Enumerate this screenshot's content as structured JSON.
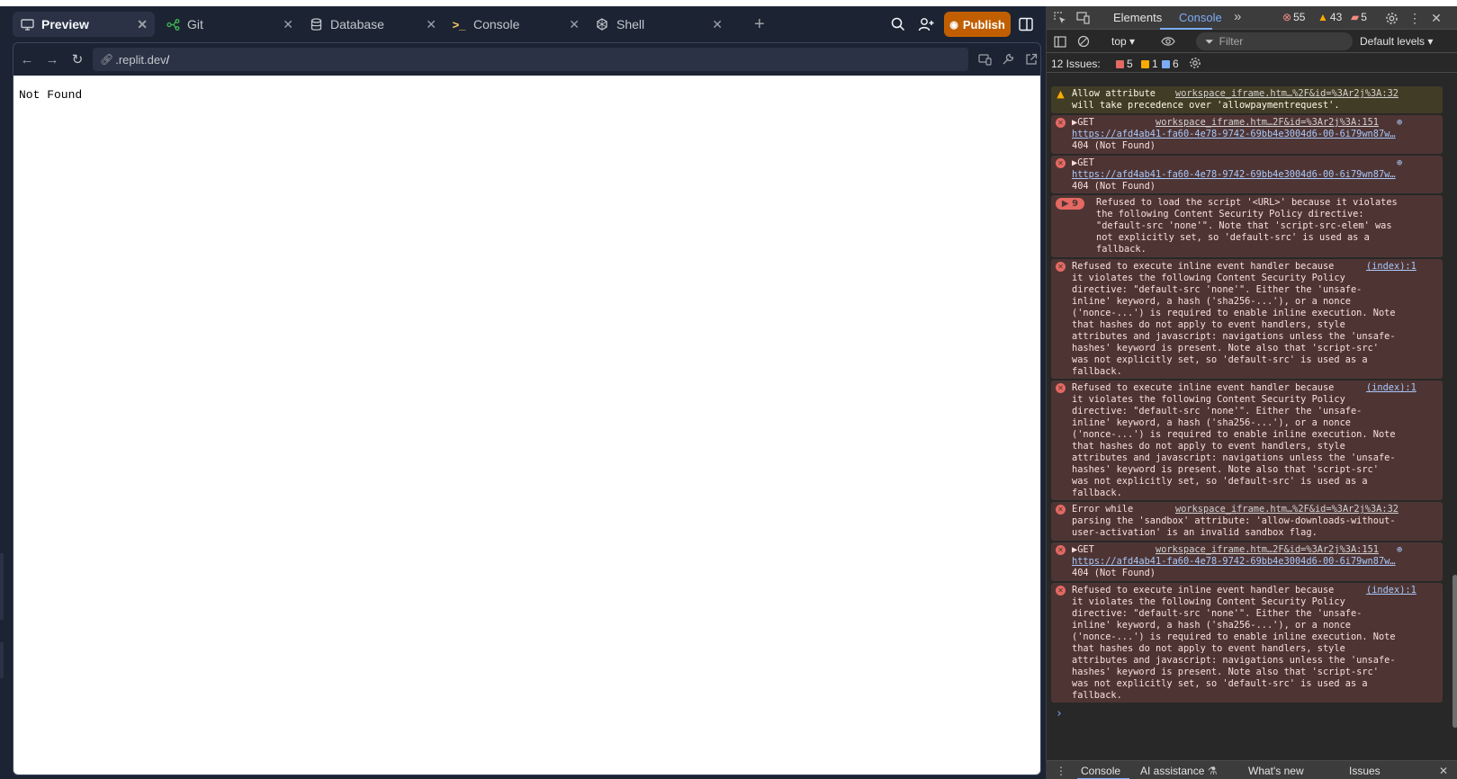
{
  "workspace": {
    "tabs": [
      {
        "label": "Preview",
        "icon": "monitor-icon"
      },
      {
        "label": "Git",
        "icon": "git-branch-icon"
      },
      {
        "label": "Database",
        "icon": "database-icon"
      },
      {
        "label": "Console",
        "icon": "terminal-prompt-icon"
      },
      {
        "label": "Shell",
        "icon": "shell-icon"
      }
    ],
    "publish_label": "Publish",
    "url": ".replit.dev",
    "url_tail": "/",
    "page_text": "Not Found"
  },
  "devtools": {
    "tabs": [
      "Elements",
      "Console"
    ],
    "active_tab": "Console",
    "counts": {
      "errors": "55",
      "warnings": "43",
      "issues": "5"
    },
    "context": "top",
    "filter_placeholder": "Filter",
    "levels": "Default levels",
    "issues_label": "12 Issues:",
    "issue_counts": {
      "errors": "5",
      "warnings": "1",
      "info": "6"
    },
    "messages": [
      {
        "level": "warning",
        "lines": [
          "Allow attribute ",
          "will take precedence over 'allowpaymentrequest'."
        ],
        "source": "workspace_iframe.htm…%2F&id=%3Ar2j%3A:32"
      },
      {
        "level": "error",
        "lines": [
          "▶GET",
          "https://afd4ab41-fa60-4e78-9742-69bb4e3004d6-00-6i79wn87w…",
          "404 (Not Found)"
        ],
        "source": "workspace_iframe.htm…2F&id=%3Ar2j%3A:151"
      },
      {
        "level": "error",
        "lines": [
          "▶GET",
          "https://afd4ab41-fa60-4e78-9742-69bb4e3004d6-00-6i79wn87w…",
          "404 (Not Found)"
        ],
        "source": ""
      },
      {
        "level": "error",
        "repeat": "▶ 9",
        "lines": [
          "Refused to load the script '<URL>' because it violates",
          "the following Content Security Policy directive:",
          "\"default-src 'none'\". Note that 'script-src-elem' was",
          "not explicitly set, so 'default-src' is used as a",
          "fallback."
        ],
        "source": ""
      },
      {
        "level": "error",
        "lines": [
          "Refused to execute inline event handler because",
          "it violates the following Content Security Policy",
          "directive: \"default-src 'none'\". Either the 'unsafe-",
          "inline' keyword, a hash ('sha256-...'), or a nonce",
          "('nonce-...') is required to enable inline execution. Note",
          "that hashes do not apply to event handlers, style",
          "attributes and javascript: navigations unless the 'unsafe-",
          "hashes' keyword is present. Note also that 'script-src'",
          "was not explicitly set, so 'default-src' is used as a",
          "fallback."
        ],
        "source": "(index):1"
      },
      {
        "level": "error",
        "lines": [
          "Refused to execute inline event handler because",
          "it violates the following Content Security Policy",
          "directive: \"default-src 'none'\". Either the 'unsafe-",
          "inline' keyword, a hash ('sha256-...'), or a nonce",
          "('nonce-...') is required to enable inline execution. Note",
          "that hashes do not apply to event handlers, style",
          "attributes and javascript: navigations unless the 'unsafe-",
          "hashes' keyword is present. Note also that 'script-src'",
          "was not explicitly set, so 'default-src' is used as a",
          "fallback."
        ],
        "source": "(index):1"
      },
      {
        "level": "error",
        "lines": [
          "Error while",
          "parsing the 'sandbox' attribute: 'allow-downloads-without-",
          "user-activation' is an invalid sandbox flag."
        ],
        "source": "workspace_iframe.htm…%2F&id=%3Ar2j%3A:32"
      },
      {
        "level": "error",
        "lines": [
          "▶GET",
          "https://afd4ab41-fa60-4e78-9742-69bb4e3004d6-00-6i79wn87w…",
          "404 (Not Found)"
        ],
        "source": "workspace_iframe.htm…2F&id=%3Ar2j%3A:151"
      },
      {
        "level": "error",
        "lines": [
          "Refused to execute inline event handler because",
          "it violates the following Content Security Policy",
          "directive: \"default-src 'none'\". Either the 'unsafe-",
          "inline' keyword, a hash ('sha256-...'), or a nonce",
          "('nonce-...') is required to enable inline execution. Note",
          "that hashes do not apply to event handlers, style",
          "attributes and javascript: navigations unless the 'unsafe-",
          "hashes' keyword is present. Note also that 'script-src'",
          "was not explicitly set, so 'default-src' is used as a",
          "fallback."
        ],
        "source": "(index):1"
      }
    ],
    "drawer_tabs": [
      "Console",
      "AI assistance",
      "What's new",
      "Issues"
    ],
    "colors": {
      "error_bg": "#4e3534",
      "warning_bg": "#413c26",
      "accent": "#7cacf8",
      "publish": "#c15f00"
    }
  }
}
